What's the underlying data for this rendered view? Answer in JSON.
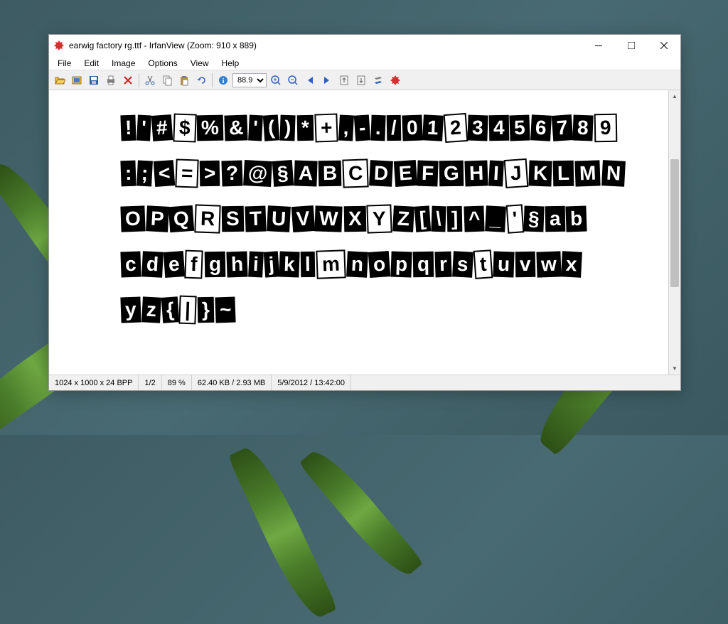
{
  "window": {
    "title": "earwig factory rg.ttf - IrfanView (Zoom: 910 x 889)"
  },
  "menu": {
    "file": "File",
    "edit": "Edit",
    "image": "Image",
    "options": "Options",
    "view": "View",
    "help": "Help"
  },
  "toolbar": {
    "zoom_value": "88.9"
  },
  "status": {
    "dimensions": "1024 x 1000 x 24 BPP",
    "page": "1/2",
    "zoom": "89 %",
    "size": "62.40 KB / 2.93 MB",
    "datetime": "5/9/2012 / 13:42:00"
  },
  "glyphs": {
    "row1": [
      "!",
      "'",
      "#",
      "$",
      "%",
      "&",
      "'",
      "(",
      ")",
      "*",
      "+",
      ",",
      "-",
      ".",
      "/",
      "0",
      "1",
      "2",
      "3",
      "4",
      "5",
      "6",
      "7",
      "8",
      "9"
    ],
    "row2": [
      ":",
      ";",
      "<",
      "=",
      ">",
      "?",
      "@",
      "§",
      "A",
      "B",
      "C",
      "D",
      "E",
      "F",
      "G",
      "H",
      "I",
      "J",
      "K",
      "L",
      "M",
      "N"
    ],
    "row3": [
      "O",
      "P",
      "Q",
      "R",
      "S",
      "T",
      "U",
      "V",
      "W",
      "X",
      "Y",
      "Z",
      "[",
      "\\",
      "]",
      "^",
      "_",
      "'",
      "§",
      "a",
      "b"
    ],
    "row4": [
      "c",
      "d",
      "e",
      "f",
      "g",
      "h",
      "i",
      "j",
      "k",
      "l",
      "m",
      "n",
      "o",
      "p",
      "q",
      "r",
      "s",
      "t",
      "u",
      "v",
      "w",
      "x"
    ],
    "row5": [
      "y",
      "z",
      "{",
      "|",
      "}",
      "~"
    ]
  }
}
